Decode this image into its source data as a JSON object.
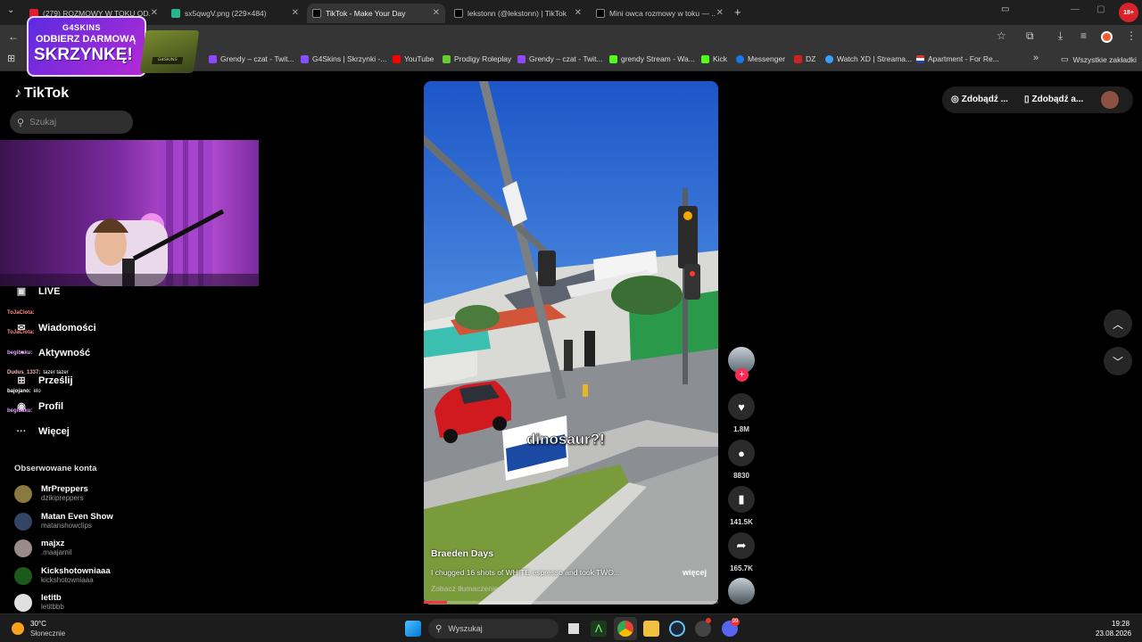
{
  "browser": {
    "tabs": [
      {
        "title": "(279) ROZMOWY W TOKU OD...",
        "color": "#e02030"
      },
      {
        "title": "sx5qwgV.png (229×484)",
        "color": "#2bb38f"
      },
      {
        "title": "TikTok - Make Your Day",
        "color": "#ffffff"
      },
      {
        "title": "lekstonn (@lekstonn) | TikTok",
        "color": "#ffffff"
      },
      {
        "title": "Mini owca rozmowy w toku — ...",
        "color": "#ffffff"
      }
    ],
    "new_tab": "+",
    "bookmarks": [
      {
        "label": "Grendy – czat - Twit...",
        "color": "#9146ff"
      },
      {
        "label": "G4Skins | Skrzynki -...",
        "color": "#8a4dff"
      },
      {
        "label": "YouTube",
        "color": "#ff0000"
      },
      {
        "label": "Prodigy Roleplay",
        "color": "#66cc33"
      },
      {
        "label": "Grendy – czat - Twit...",
        "color": "#9146ff"
      },
      {
        "label": "grendy Stream - Wa...",
        "color": "#53fc18"
      },
      {
        "label": "Kick",
        "color": "#53fc18"
      },
      {
        "label": "Messenger",
        "color": "#1877f2"
      },
      {
        "label": "DZ",
        "color": "#cc2222"
      },
      {
        "label": "Watch XD | Streama...",
        "color": "#3aa0ff"
      },
      {
        "label": "Apartment - For Re...",
        "color": "#d33"
      }
    ],
    "all_bookmarks": "Wszystkie zakładki",
    "profile_badge": "18+"
  },
  "ad": {
    "brand": "G4SKINS",
    "line1": "ODBIERZ DARMOWĄ",
    "line2": "SKRZYNKĘ!",
    "crate_label": "G4SKINS"
  },
  "tiktok": {
    "logo": "TikTok",
    "search_placeholder": "Szukaj",
    "nav": [
      {
        "label": "LIVE",
        "icon": "live-icon"
      },
      {
        "label": "Wiadomości",
        "icon": "messages-icon"
      },
      {
        "label": "Aktywność",
        "icon": "activity-icon"
      },
      {
        "label": "Prześlij",
        "icon": "upload-icon"
      },
      {
        "label": "Profil",
        "icon": "profile-icon"
      },
      {
        "label": "Więcej",
        "icon": "more-icon"
      }
    ],
    "following_header": "Obserwowane konta",
    "following": [
      {
        "name": "MrPreppers",
        "handle": "dzikipreppers",
        "color": "#8a7a40"
      },
      {
        "name": "Matan Even Show",
        "handle": "matanshowclips",
        "color": "#334466"
      },
      {
        "name": "majxz",
        "handle": ".maajamil",
        "color": "#9a8a8a"
      },
      {
        "name": "Kickshotowniaaa",
        "handle": "kickshotowniaaa",
        "color": "#1a5a1a"
      },
      {
        "name": "letitb",
        "handle": "letitbbb",
        "color": "#e0e0e0"
      }
    ],
    "get_coins": "Zdobądź ...",
    "get_app": "Zdobądź a...",
    "video": {
      "caption": "dinosaur?!",
      "author": "Braeden Days",
      "description": "I chugged 16 shots of WHITE espresso and took TWO...",
      "more": "więcej",
      "translate": "Zobacz tłumaczenie",
      "progress": 0.08
    },
    "actions": {
      "likes": "1.8M",
      "comments": "8830",
      "saves": "141.5K",
      "shares": "165.7K"
    }
  },
  "chat": [
    {
      "user": "ToJaCiota:",
      "msg": "",
      "color": "#ff8a8a"
    },
    {
      "user": "ToJaCiota:",
      "msg": "",
      "color": "#ff8a8a"
    },
    {
      "user": "begibaku:",
      "msg": "",
      "color": "#e8a0ff"
    },
    {
      "user": "Dudus_1337:",
      "msg": "tazer tazer",
      "color": "#ffb3b3"
    },
    {
      "user": "bajojano:",
      "msg": "elo",
      "color": "#ffffff"
    },
    {
      "user": "begibaku:",
      "msg": "",
      "color": "#e8a0ff"
    }
  ],
  "taskbar": {
    "temperature": "30°C",
    "weather": "Słonecznie",
    "search_label": "Wyszukaj",
    "time": "19:28",
    "date": "23.08.2026",
    "discord_badge": "99"
  }
}
